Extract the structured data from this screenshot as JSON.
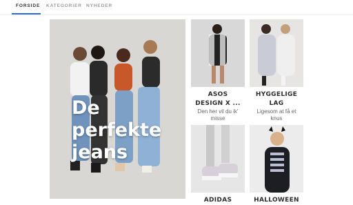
{
  "nav": {
    "tabs": [
      {
        "label": "FORSIDE",
        "active": true
      },
      {
        "label": "KATEGORIER",
        "active": false
      },
      {
        "label": "NYHEDER",
        "active": false
      }
    ],
    "accent_color": "#2d6de0"
  },
  "hero": {
    "title_line1": "De",
    "title_line2": "perfekte",
    "title_line3": "jeans"
  },
  "tiles": [
    {
      "title_line1": "ASOS",
      "title_line2": "DESIGN X ...",
      "sub_line1": "Den her vil du ik'",
      "sub_line2": "misse"
    },
    {
      "title_line1": "HYGGELIGE",
      "title_line2": "LAG",
      "sub_line1": "Ligesom at få et",
      "sub_line2": "knus"
    },
    {
      "title_line1": "ADIDAS",
      "title_line2": "",
      "sub_line1": "",
      "sub_line2": ""
    },
    {
      "title_line1": "HALLOWEEN",
      "title_line2": "",
      "sub_line1": "",
      "sub_line2": ""
    }
  ]
}
